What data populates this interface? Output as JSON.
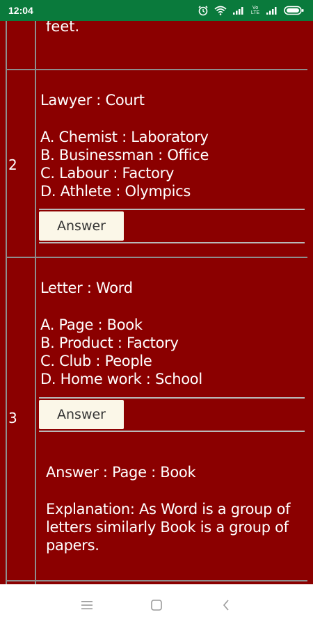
{
  "status_bar": {
    "time": "12:04",
    "icons": [
      "alarm-icon",
      "wifi-icon",
      "signal-icon",
      "volte-icon",
      "signal-icon",
      "battery-icon"
    ],
    "volte_label": "Vo LTE"
  },
  "colors": {
    "status_bar_bg": "#0a7a3c",
    "content_bg": "#8b0000",
    "answer_button_bg": "#fbf7e8",
    "grid_line": "#8e8e8e"
  },
  "rows": [
    {
      "partial_text": "feet."
    },
    {
      "number": "2",
      "question": "Lawyer : Court",
      "options": [
        "A. Chemist : Laboratory",
        "B. Businessman : Office",
        "C. Labour : Factory",
        "D. Athlete : Olympics"
      ],
      "answer_button": "Answer"
    },
    {
      "number": "3",
      "question": "Letter : Word",
      "options": [
        "A. Page : Book",
        "B. Product : Factory",
        "C. Club : People",
        "D. Home work : School"
      ],
      "answer_button": "Answer",
      "answer_text": "Answer : Page : Book",
      "explanation": "Explanation: As Word is a group of letters similarly Book is a group of papers."
    }
  ],
  "nav_bar": {
    "buttons": [
      "menu-icon",
      "home-icon",
      "back-icon"
    ]
  }
}
